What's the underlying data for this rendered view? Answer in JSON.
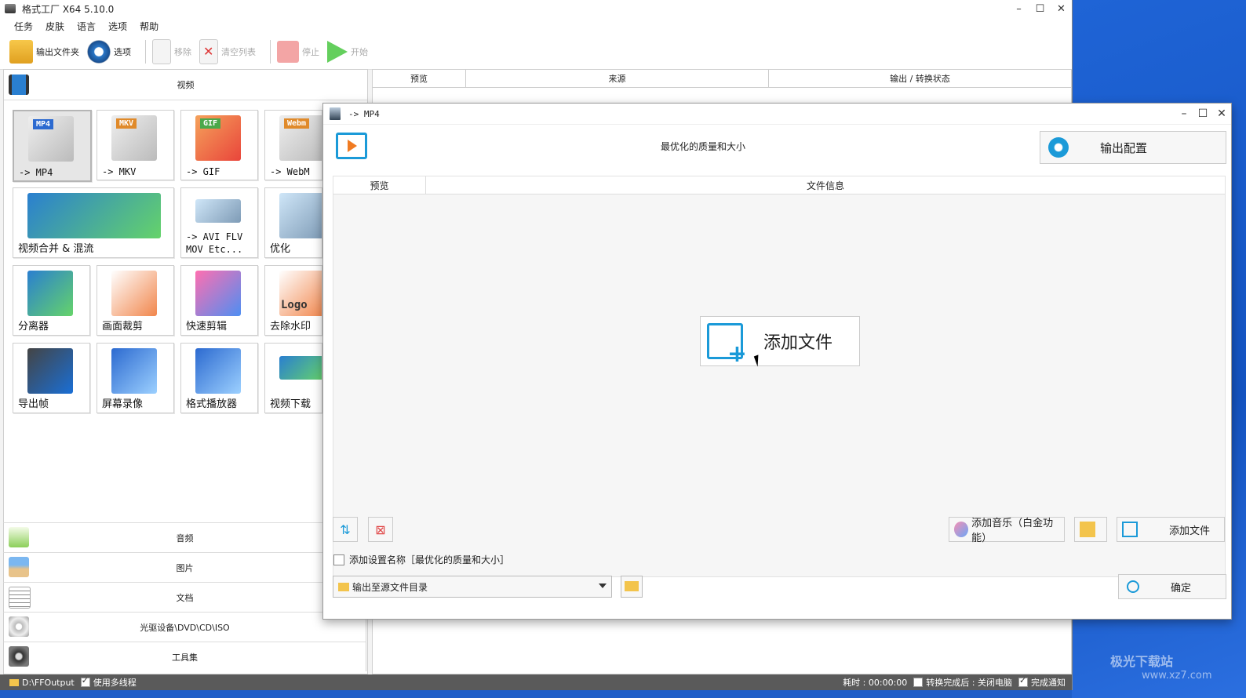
{
  "app": {
    "title": "格式工厂 X64 5.10.0",
    "win_min": "–",
    "win_max": "☐",
    "win_close": "✕"
  },
  "menu": [
    "任务",
    "皮肤",
    "语言",
    "选项",
    "帮助"
  ],
  "toolbar": {
    "output_folder": "输出文件夹",
    "options": "选项",
    "remove": "移除",
    "clear_list": "清空列表",
    "stop": "停止",
    "start": "开始"
  },
  "left": {
    "video_header": "视频",
    "tiles": [
      {
        "label": "-> MP4",
        "badge": "MP4",
        "badge_color": "#2c6ad0"
      },
      {
        "label": "-> MKV",
        "badge": "MKV",
        "badge_color": "#e08a2a"
      },
      {
        "label": "-> GIF",
        "badge": "GIF",
        "badge_color": "#4aa84a"
      },
      {
        "label": "-> WebM",
        "badge": "Webm",
        "badge_color": "#e08a2a"
      },
      {
        "label": "视频合并 & 混流"
      },
      {
        "label": "-> AVI FLV\nMOV Etc..."
      },
      {
        "label": "优化"
      },
      {
        "label": "分离器"
      },
      {
        "label": "画面裁剪"
      },
      {
        "label": "快速剪辑"
      },
      {
        "label": "去除水印",
        "overlay": "Logo"
      },
      {
        "label": "导出帧"
      },
      {
        "label": "屏幕录像"
      },
      {
        "label": "格式播放器"
      },
      {
        "label": "视频下载"
      }
    ],
    "categories": [
      "音频",
      "图片",
      "文档",
      "光驱设备\\DVD\\CD\\ISO",
      "工具集"
    ]
  },
  "list": {
    "col_preview": "预览",
    "col_source": "来源",
    "col_output": "输出 / 转换状态"
  },
  "status": {
    "path": "D:\\FFOutput",
    "multithread": "使用多线程",
    "elapsed": "耗时 : 00:00:00",
    "after_done": "转换完成后 : 关闭电脑",
    "notify": "完成通知"
  },
  "dialog": {
    "title": "-> MP4",
    "quality": "最优化的质量和大小",
    "output_config": "输出配置",
    "col_preview": "预览",
    "col_fileinfo": "文件信息",
    "add_file_big": "添加文件",
    "add_music": "添加音乐（白金功能）",
    "add_file": "添加文件",
    "add_setting_name": "添加设置名称［最优化的质量和大小］",
    "output_dir": "输出至源文件目录",
    "ok": "确定"
  },
  "watermark": {
    "line1": "极光下载站",
    "line2": "www.xz7.com"
  },
  "colors": {
    "accent": "#1b9ad8",
    "folder": "#f3c44c",
    "desktop": "#1f5fc8"
  }
}
